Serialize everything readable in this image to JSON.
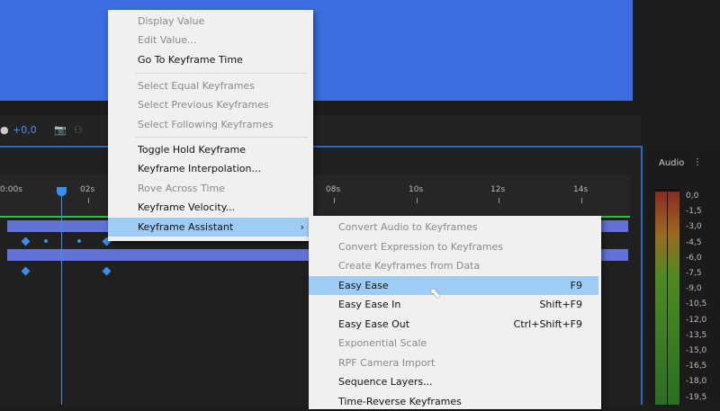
{
  "toolbar": {
    "offset": "+0,0"
  },
  "ruler": {
    "ticks": [
      "0:00s",
      "02s",
      "08s",
      "10s",
      "12s",
      "14s"
    ]
  },
  "audio": {
    "title": "Audio",
    "menu_icon": "⋮",
    "levels": [
      "0,0",
      "-1,5",
      "-3,0",
      "-4,5",
      "-6,0",
      "-7,5",
      "-9,0",
      "-10,5",
      "-12,0",
      "-13,5",
      "-15,0",
      "-16,5",
      "-18,0",
      "-19,5"
    ]
  },
  "context_menu": {
    "items": [
      {
        "label": "Display Value",
        "disabled": true
      },
      {
        "label": "Edit Value...",
        "disabled": true
      },
      {
        "label": "Go To Keyframe Time",
        "disabled": false
      },
      {
        "label": "Select Equal Keyframes",
        "disabled": true
      },
      {
        "label": "Select Previous Keyframes",
        "disabled": true
      },
      {
        "label": "Select Following Keyframes",
        "disabled": true
      },
      {
        "label": "Toggle Hold Keyframe",
        "disabled": false
      },
      {
        "label": "Keyframe Interpolation...",
        "disabled": false
      },
      {
        "label": "Rove Across Time",
        "disabled": true
      },
      {
        "label": "Keyframe Velocity...",
        "disabled": false
      },
      {
        "label": "Keyframe Assistant",
        "disabled": false,
        "submenu_arrow": "›"
      }
    ]
  },
  "submenu": {
    "items": [
      {
        "label": "Convert Audio to Keyframes",
        "shortcut": ""
      },
      {
        "label": "Convert Expression to Keyframes",
        "shortcut": ""
      },
      {
        "label": "Create Keyframes from Data",
        "shortcut": ""
      },
      {
        "label": "Easy Ease",
        "shortcut": "F9"
      },
      {
        "label": "Easy Ease In",
        "shortcut": "Shift+F9"
      },
      {
        "label": "Easy Ease Out",
        "shortcut": "Ctrl+Shift+F9"
      },
      {
        "label": "Exponential Scale",
        "shortcut": ""
      },
      {
        "label": "RPF Camera Import",
        "shortcut": ""
      },
      {
        "label": "Sequence Layers...",
        "shortcut": ""
      },
      {
        "label": "Time-Reverse Keyframes",
        "shortcut": ""
      }
    ]
  }
}
